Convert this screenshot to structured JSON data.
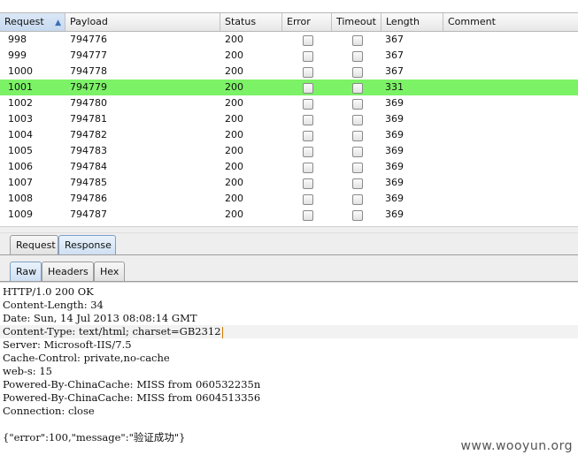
{
  "columns": {
    "request": "Request",
    "payload": "Payload",
    "status": "Status",
    "error": "Error",
    "timeout": "Timeout",
    "length": "Length",
    "comment": "Comment"
  },
  "sort_indicator": "▲",
  "rows": [
    {
      "request": "998",
      "payload": "794776",
      "status": "200",
      "length": "367",
      "highlight": false
    },
    {
      "request": "999",
      "payload": "794777",
      "status": "200",
      "length": "367",
      "highlight": false
    },
    {
      "request": "1000",
      "payload": "794778",
      "status": "200",
      "length": "367",
      "highlight": false
    },
    {
      "request": "1001",
      "payload": "794779",
      "status": "200",
      "length": "331",
      "highlight": true
    },
    {
      "request": "1002",
      "payload": "794780",
      "status": "200",
      "length": "369",
      "highlight": false
    },
    {
      "request": "1003",
      "payload": "794781",
      "status": "200",
      "length": "369",
      "highlight": false
    },
    {
      "request": "1004",
      "payload": "794782",
      "status": "200",
      "length": "369",
      "highlight": false
    },
    {
      "request": "1005",
      "payload": "794783",
      "status": "200",
      "length": "369",
      "highlight": false
    },
    {
      "request": "1006",
      "payload": "794784",
      "status": "200",
      "length": "369",
      "highlight": false
    },
    {
      "request": "1007",
      "payload": "794785",
      "status": "200",
      "length": "369",
      "highlight": false
    },
    {
      "request": "1008",
      "payload": "794786",
      "status": "200",
      "length": "369",
      "highlight": false
    },
    {
      "request": "1009",
      "payload": "794787",
      "status": "200",
      "length": "369",
      "highlight": false
    }
  ],
  "highlight_color": "#7cf266",
  "message_tabs": {
    "request": "Request",
    "response": "Response",
    "active": "Response"
  },
  "view_tabs": {
    "raw": "Raw",
    "headers": "Headers",
    "hex": "Hex",
    "active": "Raw"
  },
  "response_lines": [
    "HTTP/1.0 200 OK",
    "Content-Length: 34",
    "Date: Sun, 14 Jul 2013 08:08:14 GMT",
    "Content-Type: text/html; charset=GB2312",
    "Server: Microsoft-IIS/7.5",
    "Cache-Control: private,no-cache",
    "web-s: 15",
    "Powered-By-ChinaCache: MISS from 060532235n",
    "Powered-By-ChinaCache: MISS from 0604513356",
    "Connection: close"
  ],
  "response_body": "{\"error\":100,\"message\":\"验证成功\"}",
  "watermark": "www.wooyun.org"
}
